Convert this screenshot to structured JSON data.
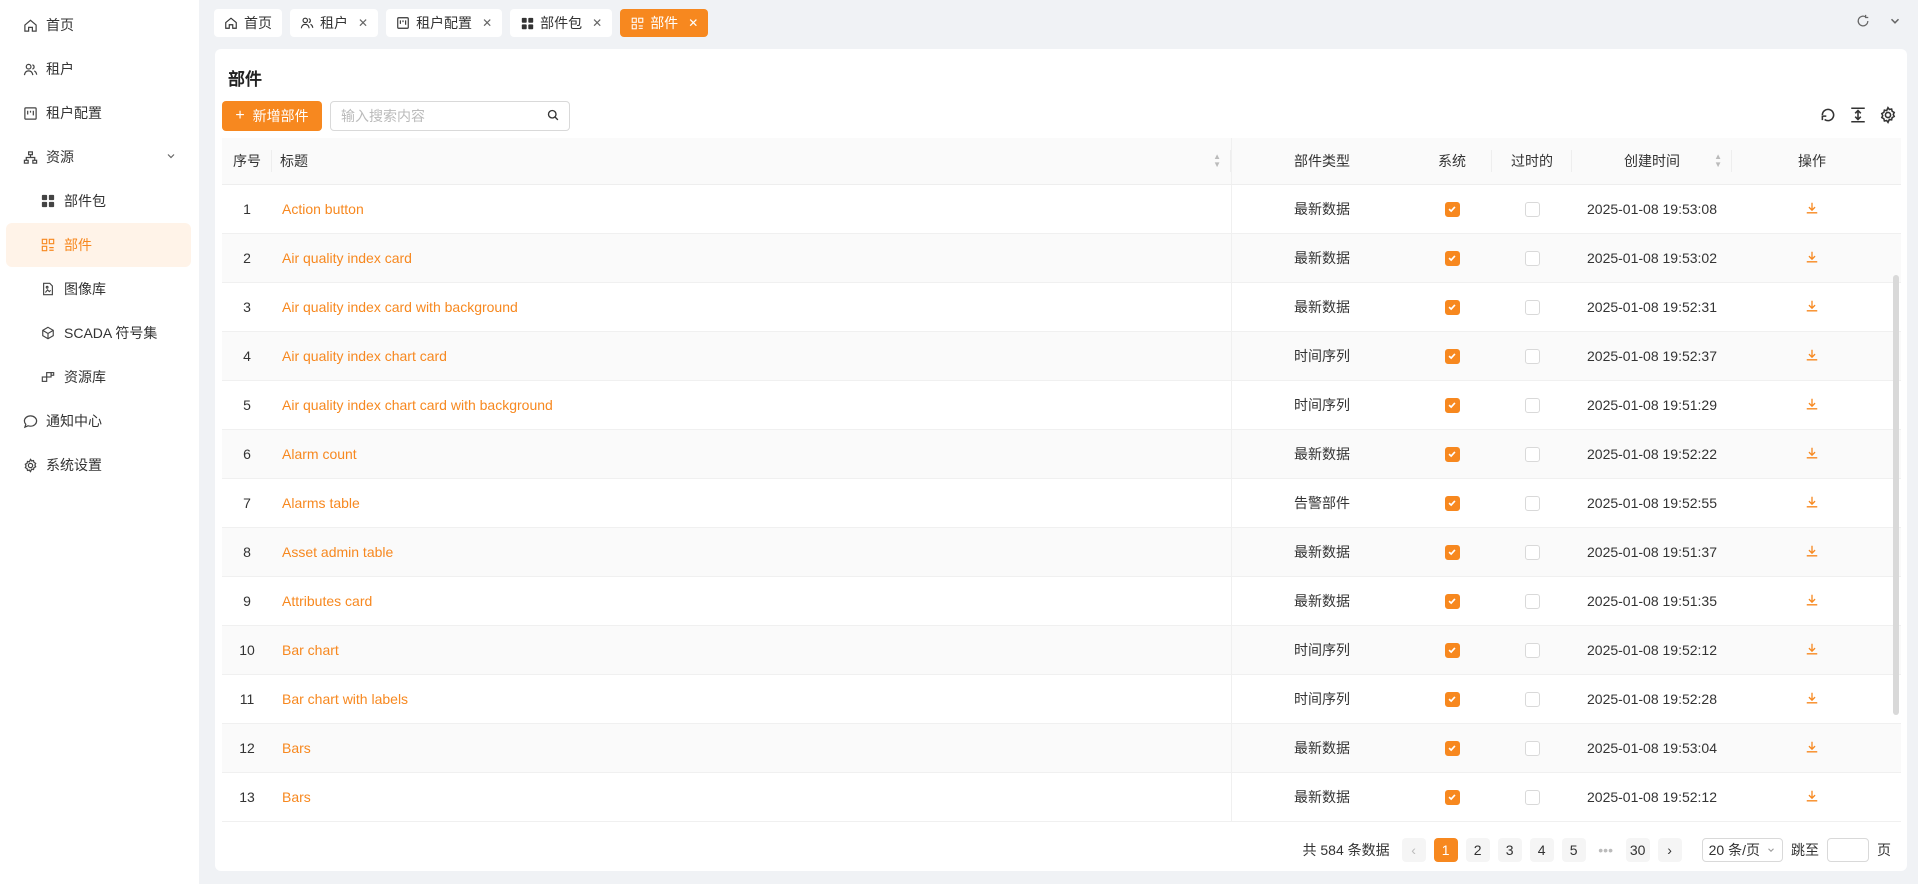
{
  "sidebar": {
    "items": [
      {
        "label": "首页",
        "icon": "home-icon"
      },
      {
        "label": "租户",
        "icon": "users-icon"
      },
      {
        "label": "租户配置",
        "icon": "board-icon"
      },
      {
        "label": "资源",
        "icon": "sitemap-icon"
      },
      {
        "label": "部件包",
        "icon": "grid-icon"
      },
      {
        "label": "部件",
        "icon": "widget-icon"
      },
      {
        "label": "图像库",
        "icon": "file-image-icon"
      },
      {
        "label": "SCADA 符号集",
        "icon": "cube-icon"
      },
      {
        "label": "资源库",
        "icon": "package-icon"
      },
      {
        "label": "通知中心",
        "icon": "chat-icon"
      },
      {
        "label": "系统设置",
        "icon": "gear-icon"
      }
    ]
  },
  "tabs": [
    {
      "label": "首页",
      "icon": "home-icon"
    },
    {
      "label": "租户",
      "icon": "users-icon"
    },
    {
      "label": "租户配置",
      "icon": "board-icon"
    },
    {
      "label": "部件包",
      "icon": "grid-icon"
    },
    {
      "label": "部件",
      "icon": "widget-icon"
    }
  ],
  "page": {
    "title": "部件",
    "add_button": "新增部件",
    "search_placeholder": "输入搜索内容"
  },
  "table": {
    "headers": {
      "index": "序号",
      "title": "标题",
      "type": "部件类型",
      "system": "系统",
      "deprecated": "过时的",
      "created": "创建时间",
      "actions": "操作"
    },
    "rows": [
      {
        "index": "1",
        "title": "Action button",
        "type": "最新数据",
        "system": true,
        "deprecated": false,
        "created": "2025-01-08 19:53:08"
      },
      {
        "index": "2",
        "title": "Air quality index card",
        "type": "最新数据",
        "system": true,
        "deprecated": false,
        "created": "2025-01-08 19:53:02"
      },
      {
        "index": "3",
        "title": "Air quality index card with background",
        "type": "最新数据",
        "system": true,
        "deprecated": false,
        "created": "2025-01-08 19:52:31"
      },
      {
        "index": "4",
        "title": "Air quality index chart card",
        "type": "时间序列",
        "system": true,
        "deprecated": false,
        "created": "2025-01-08 19:52:37"
      },
      {
        "index": "5",
        "title": "Air quality index chart card with background",
        "type": "时间序列",
        "system": true,
        "deprecated": false,
        "created": "2025-01-08 19:51:29"
      },
      {
        "index": "6",
        "title": "Alarm count",
        "type": "最新数据",
        "system": true,
        "deprecated": false,
        "created": "2025-01-08 19:52:22"
      },
      {
        "index": "7",
        "title": "Alarms table",
        "type": "告警部件",
        "system": true,
        "deprecated": false,
        "created": "2025-01-08 19:52:55"
      },
      {
        "index": "8",
        "title": "Asset admin table",
        "type": "最新数据",
        "system": true,
        "deprecated": false,
        "created": "2025-01-08 19:51:37"
      },
      {
        "index": "9",
        "title": "Attributes card",
        "type": "最新数据",
        "system": true,
        "deprecated": false,
        "created": "2025-01-08 19:51:35"
      },
      {
        "index": "10",
        "title": "Bar chart",
        "type": "时间序列",
        "system": true,
        "deprecated": false,
        "created": "2025-01-08 19:52:12"
      },
      {
        "index": "11",
        "title": "Bar chart with labels",
        "type": "时间序列",
        "system": true,
        "deprecated": false,
        "created": "2025-01-08 19:52:28"
      },
      {
        "index": "12",
        "title": "Bars",
        "type": "最新数据",
        "system": true,
        "deprecated": false,
        "created": "2025-01-08 19:53:04"
      },
      {
        "index": "13",
        "title": "Bars",
        "type": "最新数据",
        "system": true,
        "deprecated": false,
        "created": "2025-01-08 19:52:12"
      }
    ]
  },
  "pagination": {
    "total_text": "共 584 条数据",
    "pages": [
      "1",
      "2",
      "3",
      "4",
      "5"
    ],
    "ellipsis": "•••",
    "last_page": "30",
    "current": "1",
    "page_size": "20 条/页",
    "jump_label": "跳至",
    "page_suffix": "页"
  },
  "colors": {
    "accent": "#f7881f",
    "accent_bg": "#fff3e8"
  }
}
